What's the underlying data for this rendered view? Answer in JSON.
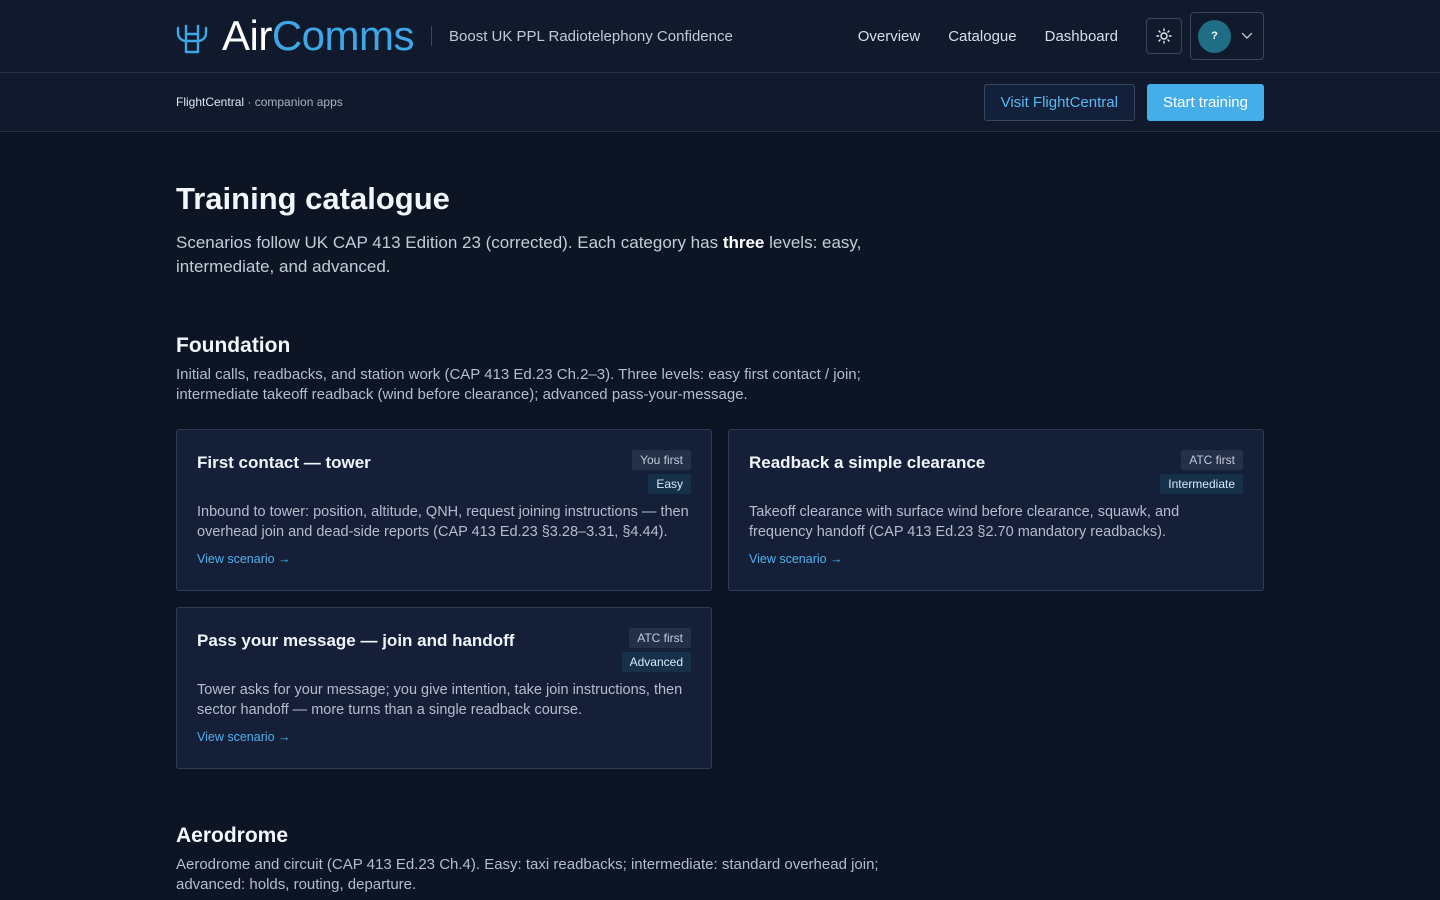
{
  "header": {
    "brand_air": "Air",
    "brand_comms": "Comms",
    "tagline": "Boost UK PPL Radiotelephony Confidence",
    "nav": [
      "Overview",
      "Catalogue",
      "Dashboard"
    ],
    "avatar_initial": "?"
  },
  "subbar": {
    "companion_brand": "FlightCentral",
    "companion_suffix": " · companion apps",
    "visit_label": "Visit FlightCentral",
    "start_label": "Start training"
  },
  "page": {
    "title": "Training catalogue",
    "intro_before": "Scenarios follow UK CAP 413 Edition 23 (corrected). Each category has ",
    "intro_bold": "three",
    "intro_after": " levels: easy, intermediate, and advanced."
  },
  "sections": [
    {
      "title": "Foundation",
      "description": "Initial calls, readbacks, and station work (CAP 413 Ed.23 Ch.2–3). Three levels: easy first contact / join; intermediate takeoff readback (wind before clearance); advanced pass-your-message.",
      "cards": [
        {
          "title": "First contact — tower",
          "who": "You first",
          "level": "Easy",
          "description": "Inbound to tower: position, altitude, QNH, request joining instructions — then overhead join and dead-side reports (CAP 413 Ed.23 §3.28–3.31, §4.44).",
          "link": "View scenario →"
        },
        {
          "title": "Readback a simple clearance",
          "who": "ATC first",
          "level": "Intermediate",
          "description": "Takeoff clearance with surface wind before clearance, squawk, and frequency handoff (CAP 413 Ed.23 §2.70 mandatory readbacks).",
          "link": "View scenario →"
        },
        {
          "title": "Pass your message — join and handoff",
          "who": "ATC first",
          "level": "Advanced",
          "description": "Tower asks for your message; you give intention, take join instructions, then sector handoff — more turns than a single readback course.",
          "link": "View scenario →"
        }
      ]
    },
    {
      "title": "Aerodrome",
      "description": "Aerodrome and circuit (CAP 413 Ed.23 Ch.4). Easy: taxi readbacks; intermediate: standard overhead join; advanced: holds, routing, departure."
    }
  ]
}
